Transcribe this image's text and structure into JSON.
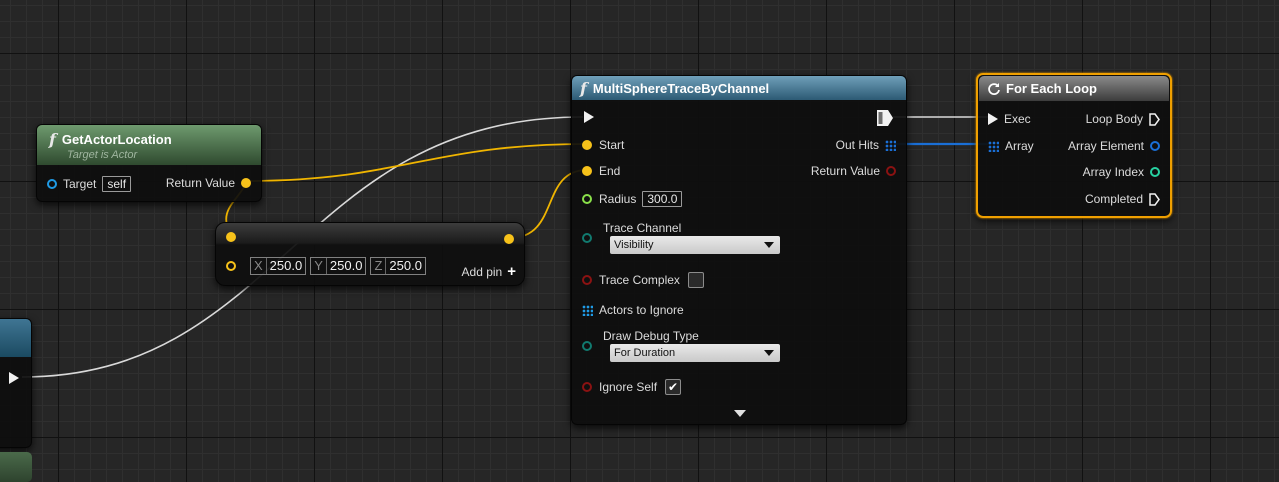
{
  "colors": {
    "exec": "#f2f2f2",
    "vector": "#f7c21a",
    "object": "#1f9be6",
    "float": "#8ae04a",
    "byte": "#117a6f",
    "bool": "#8b1212",
    "array_struct": "#1a6fd6",
    "int": "#27d1a1"
  },
  "get_actor_location": {
    "title": "GetActorLocation",
    "subtitle": "Target is Actor",
    "icon": "function-icon",
    "target_label": "Target",
    "target_value": "self",
    "return_label": "Return Value"
  },
  "make_vector": {
    "x_axis": "X",
    "x_value": "250.0",
    "y_axis": "Y",
    "y_value": "250.0",
    "z_axis": "Z",
    "z_value": "250.0",
    "add_pin_label": "Add pin",
    "add_pin_icon": "plus-icon"
  },
  "trace": {
    "title": "MultiSphereTraceByChannel",
    "icon": "function-icon",
    "start_label": "Start",
    "end_label": "End",
    "radius_label": "Radius",
    "radius_value": "300.0",
    "trace_channel_label": "Trace Channel",
    "trace_channel_value": "Visibility",
    "trace_complex_label": "Trace Complex",
    "trace_complex_checked": false,
    "actors_to_ignore_label": "Actors to Ignore",
    "draw_debug_label": "Draw Debug Type",
    "draw_debug_value": "For Duration",
    "ignore_self_label": "Ignore Self",
    "ignore_self_checked": true,
    "out_hits_label": "Out Hits",
    "return_label": "Return Value",
    "expand_icon": "chevron-down-icon"
  },
  "for_each": {
    "title": "For Each Loop",
    "icon": "loop-icon",
    "exec_label": "Exec",
    "array_label": "Array",
    "loop_body_label": "Loop Body",
    "array_element_label": "Array Element",
    "array_index_label": "Array Index",
    "completed_label": "Completed"
  }
}
